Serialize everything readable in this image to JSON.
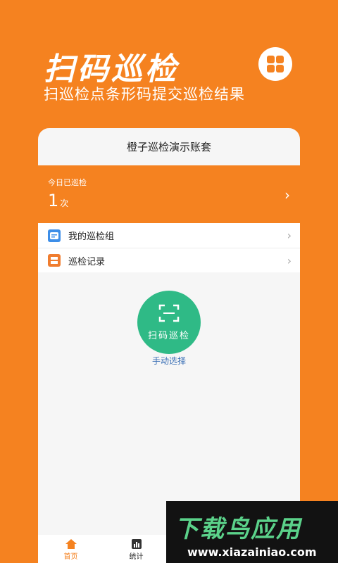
{
  "hero": {
    "title": "扫码巡检",
    "subtitle": "扫巡检点条形码提交巡检结果",
    "app_icon": "apps-grid-icon"
  },
  "card": {
    "account_name": "橙子巡检演示账套",
    "today": {
      "label": "今日已巡检",
      "count": "1",
      "unit": "次",
      "chevron": "›"
    },
    "menu": [
      {
        "label": "我的巡检组",
        "icon": "group-icon",
        "icon_color": "#3d8ee8"
      },
      {
        "label": "巡检记录",
        "icon": "record-icon",
        "icon_color": "#f07d2f"
      }
    ],
    "scan_button": {
      "label": "扫码巡检",
      "icon": "scan-frame-icon",
      "color": "#2fba86"
    },
    "manual_select": "手动选择"
  },
  "tabbar": {
    "tabs": [
      {
        "label": "首页",
        "icon": "home-icon",
        "active": true
      },
      {
        "label": "统计",
        "icon": "bar-chart-icon",
        "active": false
      }
    ]
  },
  "watermark": {
    "title": "下载鸟应用",
    "url": "www.xiazainiao.com"
  },
  "colors": {
    "brand": "#f58220",
    "scan_green": "#2fba86",
    "link_blue": "#3a6fb5"
  }
}
